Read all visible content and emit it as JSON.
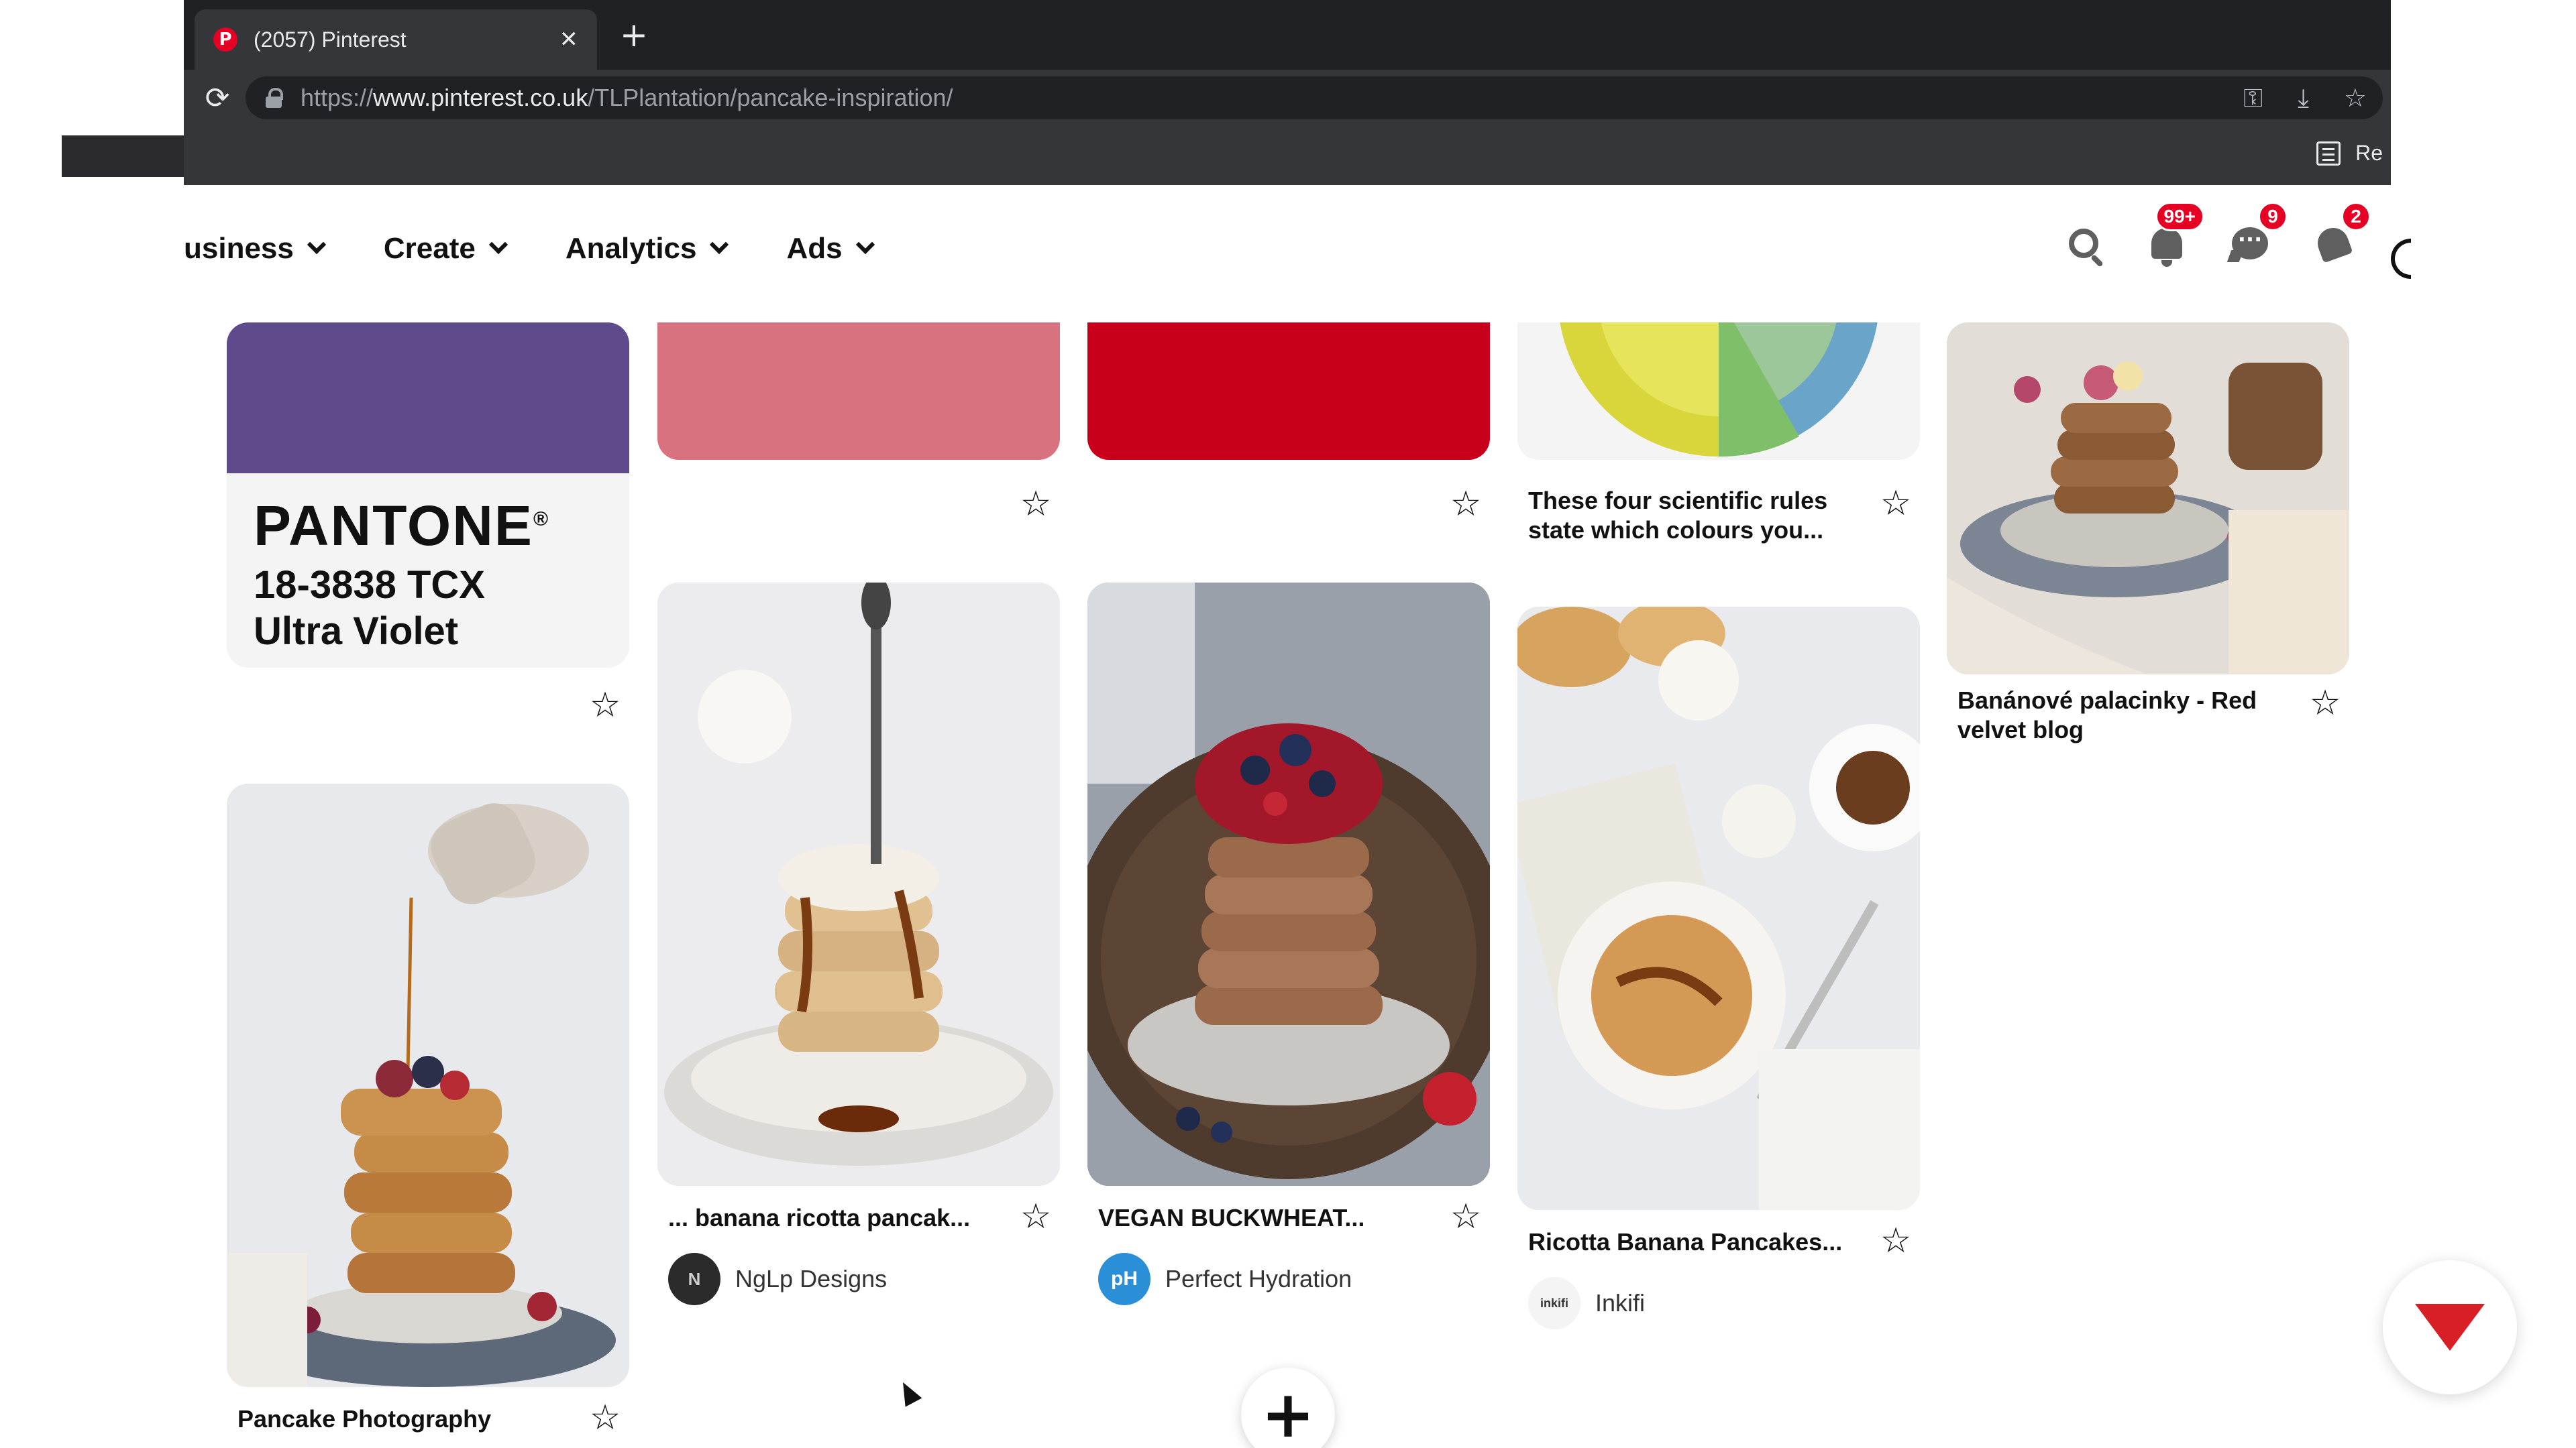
{
  "browser": {
    "tab": {
      "title": "(2057) Pinterest",
      "favicon": "P",
      "close": "✕"
    },
    "new_tab": "+",
    "reload": "⟳",
    "url": {
      "scheme": "https://",
      "host": "www.pinterest.co.uk",
      "path": "/TLPlantation/pancake-inspiration/"
    },
    "omnibox_icons": [
      "key-icon",
      "install-icon",
      "bookmark-star-icon"
    ],
    "reading_list_label": "Re"
  },
  "header": {
    "nav": [
      {
        "label": "usiness",
        "icon": "chevron-down-icon"
      },
      {
        "label": "Create",
        "icon": "chevron-down-icon"
      },
      {
        "label": "Analytics",
        "icon": "chevron-down-icon"
      },
      {
        "label": "Ads",
        "icon": "chevron-down-icon"
      }
    ],
    "icons": {
      "search": "search-icon",
      "notifications_badge": "99+",
      "messages_badge": "9",
      "updates_badge": "2"
    }
  },
  "pins": {
    "pantone": {
      "brand": "PANTONE",
      "reg": "®",
      "code": "18-3838 TCX",
      "name": "Ultra Violet"
    },
    "pink_swatch": {},
    "red_swatch": {},
    "colour_wheel": {
      "caption": "These four scientific rules state which colours you..."
    },
    "bananove": {
      "caption": "Banánové palacinky - Red velvet blog"
    },
    "pancake_photo": {
      "caption": "Pancake Photography"
    },
    "banana_ricotta": {
      "caption": "... banana ricotta pancak...",
      "creator": "NgLp Designs",
      "avatar": "N"
    },
    "vegan": {
      "caption": "VEGAN BUCKWHEAT...",
      "creator": "Perfect Hydration",
      "avatar": "pH"
    },
    "ricotta": {
      "caption": "Ricotta Banana Pancakes...",
      "creator": "Inkifi",
      "avatar": "inkifi"
    }
  },
  "star": "☆",
  "fab_plus": "+",
  "colors": {
    "pinterest_red": "#e60023",
    "ultra_violet": "#5f4b8b",
    "pink": "#d9727f",
    "red": "#c8001c"
  }
}
